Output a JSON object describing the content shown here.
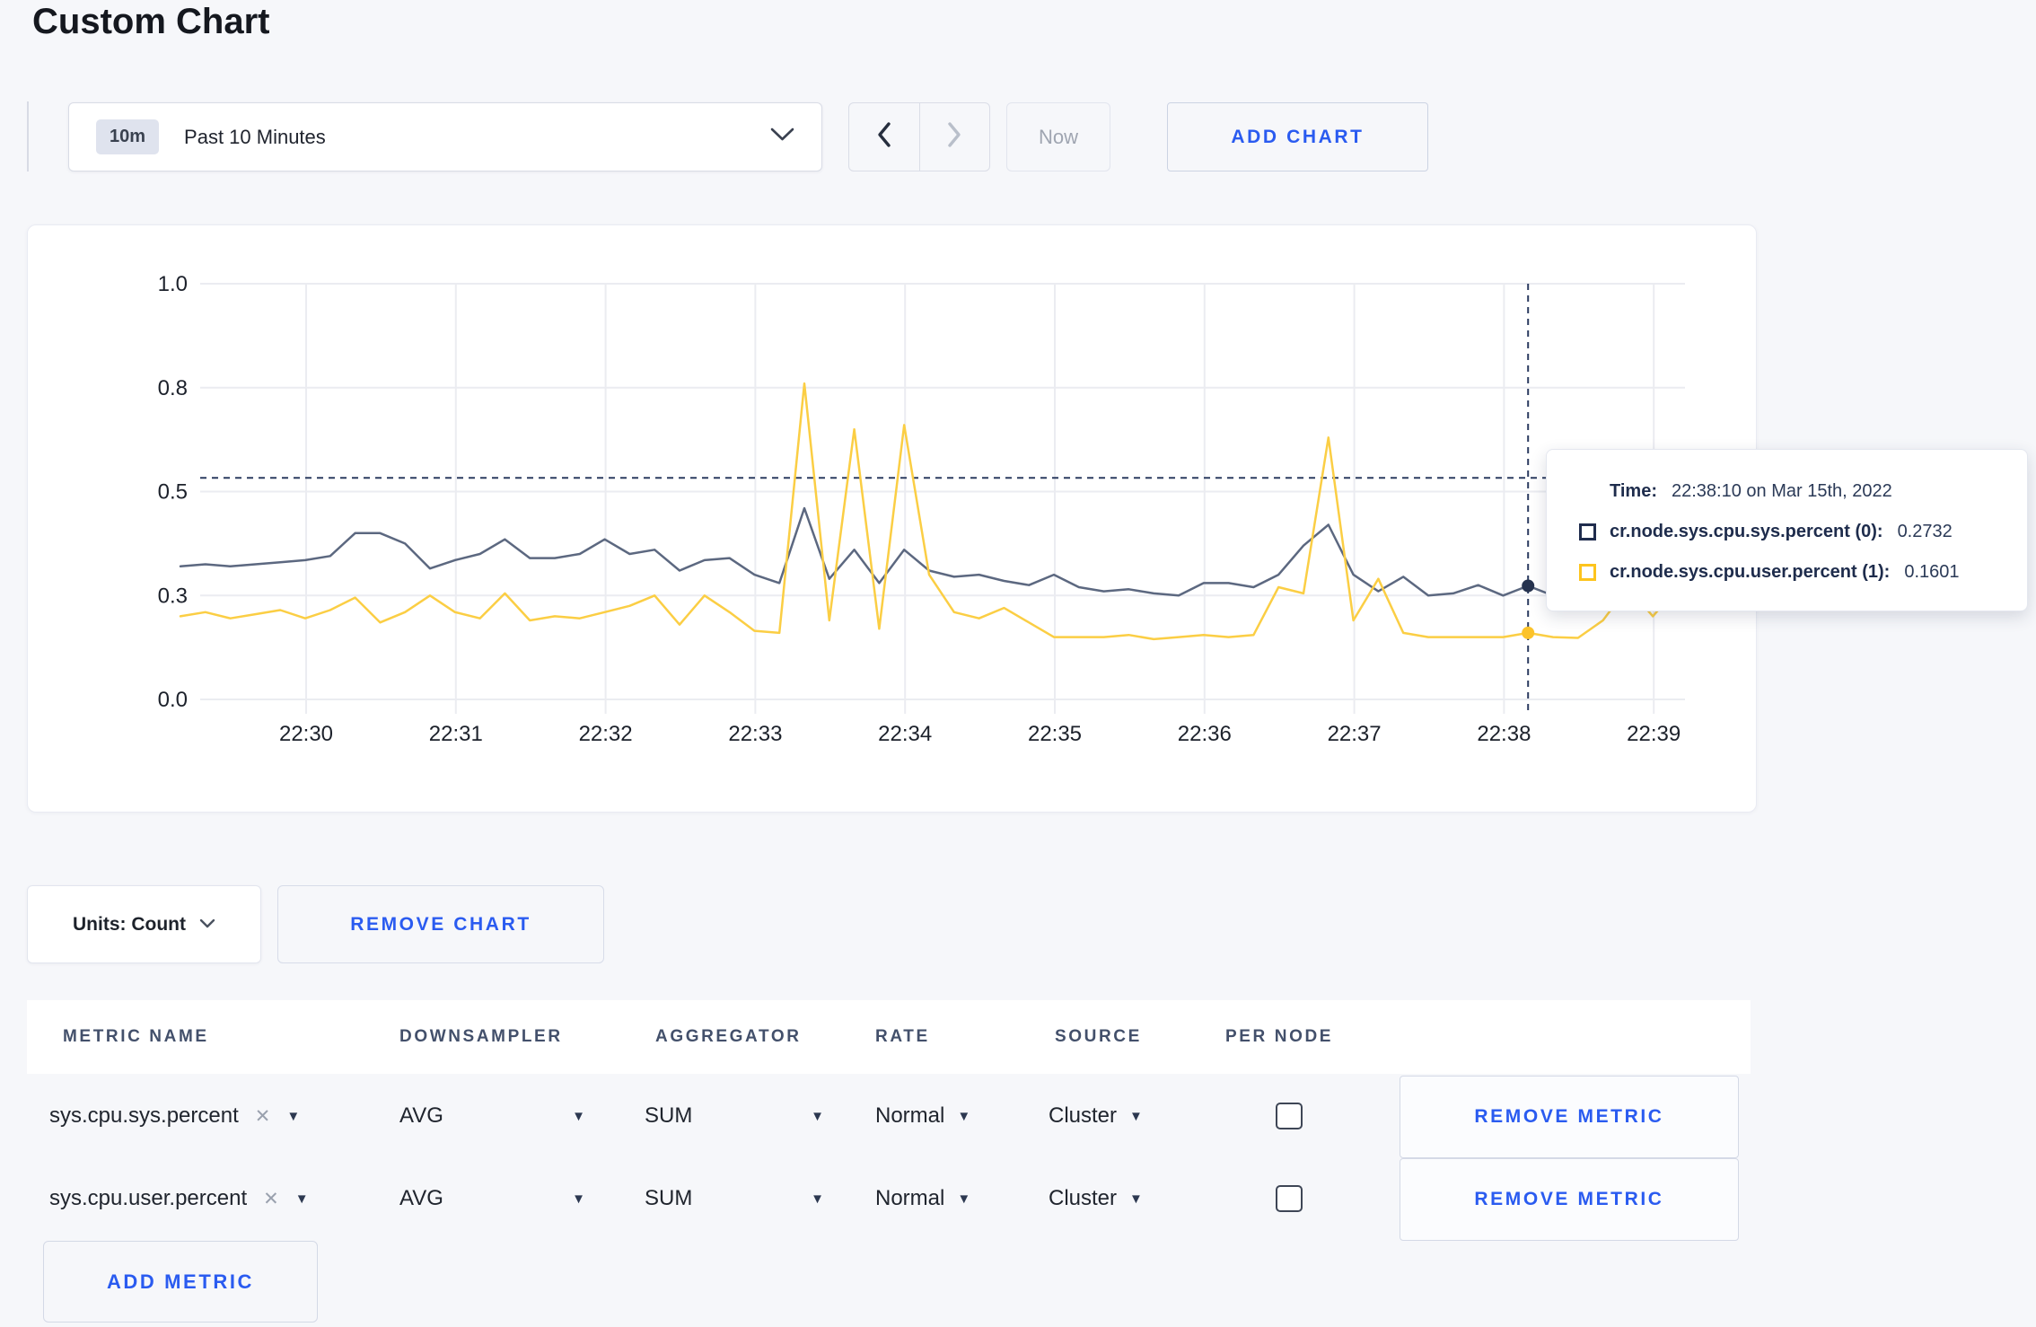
{
  "page": {
    "title": "Custom Chart"
  },
  "colors": {
    "accent_blue": "#2a5bf0",
    "page_bg": "#f6f7fa",
    "card_bg": "#ffffff",
    "grid": "#ebecf1",
    "axis_text": "#1c212b",
    "crosshair": "#2c3c60"
  },
  "toolbar": {
    "time_badge": "10m",
    "time_label": "Past 10 Minutes",
    "now_label": "Now",
    "add_chart_label": "ADD CHART"
  },
  "icons": {
    "dropdown_caret": "▼",
    "remove_x": "✕"
  },
  "chart_data": {
    "type": "line",
    "title": "",
    "xlabel": "",
    "ylabel": "",
    "x_start": "22:29:10",
    "x_step_seconds": 10,
    "x_tick_labels": [
      "22:30",
      "22:31",
      "22:32",
      "22:33",
      "22:34",
      "22:35",
      "22:36",
      "22:37",
      "22:38",
      "22:39"
    ],
    "y_ticks": {
      "values": [
        0,
        0.25,
        0.5,
        0.75,
        1.0
      ],
      "labels": [
        "0.0",
        "0.3",
        "0.5",
        "0.8",
        "1.0"
      ]
    },
    "ylim": [
      0,
      1
    ],
    "grid": true,
    "legend_position": "none",
    "series": [
      {
        "name": "cr.node.sys.cpu.sys.percent (0)",
        "color": "#5c6880",
        "swatch_color": "#1f2c4d",
        "values": [
          0.32,
          0.325,
          0.32,
          0.325,
          0.33,
          0.335,
          0.345,
          0.4,
          0.4,
          0.375,
          0.315,
          0.335,
          0.35,
          0.385,
          0.34,
          0.34,
          0.35,
          0.385,
          0.35,
          0.36,
          0.31,
          0.335,
          0.34,
          0.3,
          0.28,
          0.46,
          0.29,
          0.36,
          0.28,
          0.36,
          0.31,
          0.295,
          0.3,
          0.285,
          0.275,
          0.3,
          0.27,
          0.26,
          0.265,
          0.255,
          0.25,
          0.28,
          0.28,
          0.27,
          0.3,
          0.37,
          0.42,
          0.3,
          0.26,
          0.295,
          0.25,
          0.255,
          0.275,
          0.25,
          0.2732,
          0.25,
          0.26,
          0.27,
          0.26,
          0.27,
          0.26
        ]
      },
      {
        "name": "cr.node.sys.cpu.user.percent (1)",
        "color": "#fbce44",
        "swatch_color": "#fdc41d",
        "values": [
          0.2,
          0.21,
          0.195,
          0.205,
          0.215,
          0.195,
          0.215,
          0.245,
          0.185,
          0.21,
          0.25,
          0.21,
          0.195,
          0.255,
          0.19,
          0.2,
          0.195,
          0.21,
          0.225,
          0.25,
          0.18,
          0.25,
          0.21,
          0.165,
          0.16,
          0.76,
          0.19,
          0.65,
          0.17,
          0.66,
          0.3,
          0.21,
          0.195,
          0.22,
          0.185,
          0.15,
          0.15,
          0.15,
          0.155,
          0.145,
          0.15,
          0.155,
          0.15,
          0.155,
          0.27,
          0.255,
          0.63,
          0.19,
          0.29,
          0.16,
          0.15,
          0.15,
          0.15,
          0.15,
          0.1601,
          0.15,
          0.148,
          0.19,
          0.27,
          0.2,
          0.27
        ]
      }
    ],
    "crosshair": {
      "time": "22:38:10",
      "index": 54,
      "mouse_y_value": 0.533,
      "dots": [
        {
          "series": 0,
          "value": 0.2732,
          "color": "#26334f"
        },
        {
          "series": 1,
          "value": 0.1601,
          "color": "#fcc32a"
        }
      ]
    }
  },
  "tooltip": {
    "time_label": "Time:",
    "time_value": "22:38:10 on Mar 15th, 2022",
    "rows": [
      {
        "label": "cr.node.sys.cpu.sys.percent (0):",
        "value": "0.2732",
        "swatch_color": "#1f2c4d"
      },
      {
        "label": "cr.node.sys.cpu.user.percent (1):",
        "value": "0.1601",
        "swatch_color": "#fdc41d"
      }
    ]
  },
  "chart_controls": {
    "units_label": "Units: Count",
    "remove_chart_label": "REMOVE CHART"
  },
  "metrics_table": {
    "headers": [
      "METRIC NAME",
      "DOWNSAMPLER",
      "AGGREGATOR",
      "RATE",
      "SOURCE",
      "PER NODE"
    ],
    "rows": [
      {
        "metric": "sys.cpu.sys.percent",
        "downsampler": "AVG",
        "aggregator": "SUM",
        "rate": "Normal",
        "source": "Cluster",
        "per_node_checked": false
      },
      {
        "metric": "sys.cpu.user.percent",
        "downsampler": "AVG",
        "aggregator": "SUM",
        "rate": "Normal",
        "source": "Cluster",
        "per_node_checked": false
      }
    ],
    "remove_metric_label": "REMOVE METRIC",
    "add_metric_label": "ADD METRIC"
  }
}
